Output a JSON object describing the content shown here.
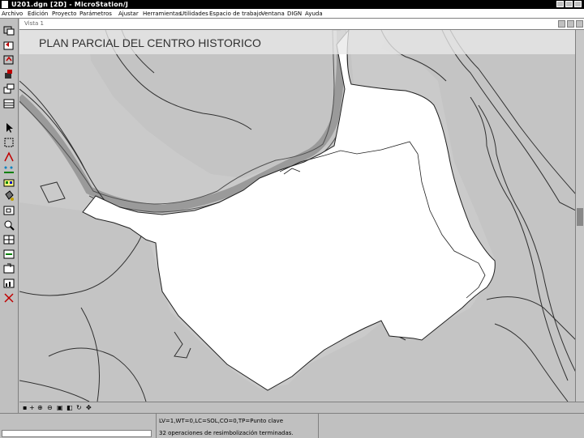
{
  "window": {
    "title": "U201.dgn [2D] - MicroStation/J"
  },
  "menubar": {
    "items": [
      "Archivo",
      "Edición",
      "Proyecto",
      "Parámetros",
      "Ajustar",
      "Herramientas",
      "Utilidades",
      "Espacio de trabajo",
      "Ventana",
      "DIGN",
      "Ayuda"
    ]
  },
  "toolbox": {
    "tools": [
      "copy-view-icon",
      "undo-view-icon",
      "fit-view-icon",
      "attach-icon",
      "window-area-icon",
      "fence-icon",
      "select-arrow-icon",
      "selection-box-icon",
      "measure-angle-icon",
      "snap-points-icon",
      "palette-icon",
      "fill-bucket-icon",
      "zoom-box-icon",
      "zoom-in-icon",
      "grid-icon",
      "dimension-icon",
      "rotate-copy-icon",
      "chart-icon",
      "delete-icon"
    ]
  },
  "view": {
    "title": "Vista 1",
    "plan_title": "PLAN PARCIAL DEL CENTRO HISTORICO"
  },
  "statusbar": {
    "line1": "LV=1,WT=0,LC=SOL,CO=0,TP=Punto clave",
    "line2": "32 operaciones de resimbolización terminadas."
  },
  "colors": {
    "background": "#c4c4c4",
    "highlight_area": "#ffffff",
    "road_lines": "#404040",
    "river": "#9a9a9a"
  }
}
